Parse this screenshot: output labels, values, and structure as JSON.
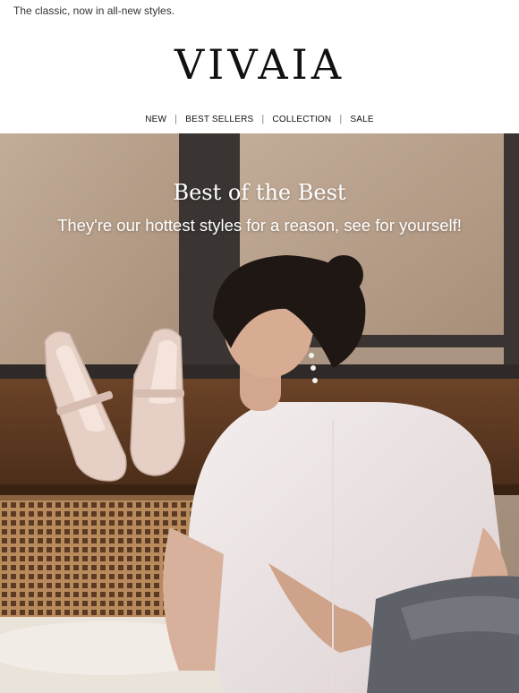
{
  "preheader": "The classic, now in all-new styles.",
  "brand": {
    "logo_text": "VIVAIA"
  },
  "nav": {
    "items": [
      "NEW",
      "BEST SELLERS",
      "COLLECTION",
      "SALE"
    ],
    "separator": "|"
  },
  "hero": {
    "title": "Best of the Best",
    "subtitle": "They're our hottest styles for a reason, see for yourself!"
  }
}
